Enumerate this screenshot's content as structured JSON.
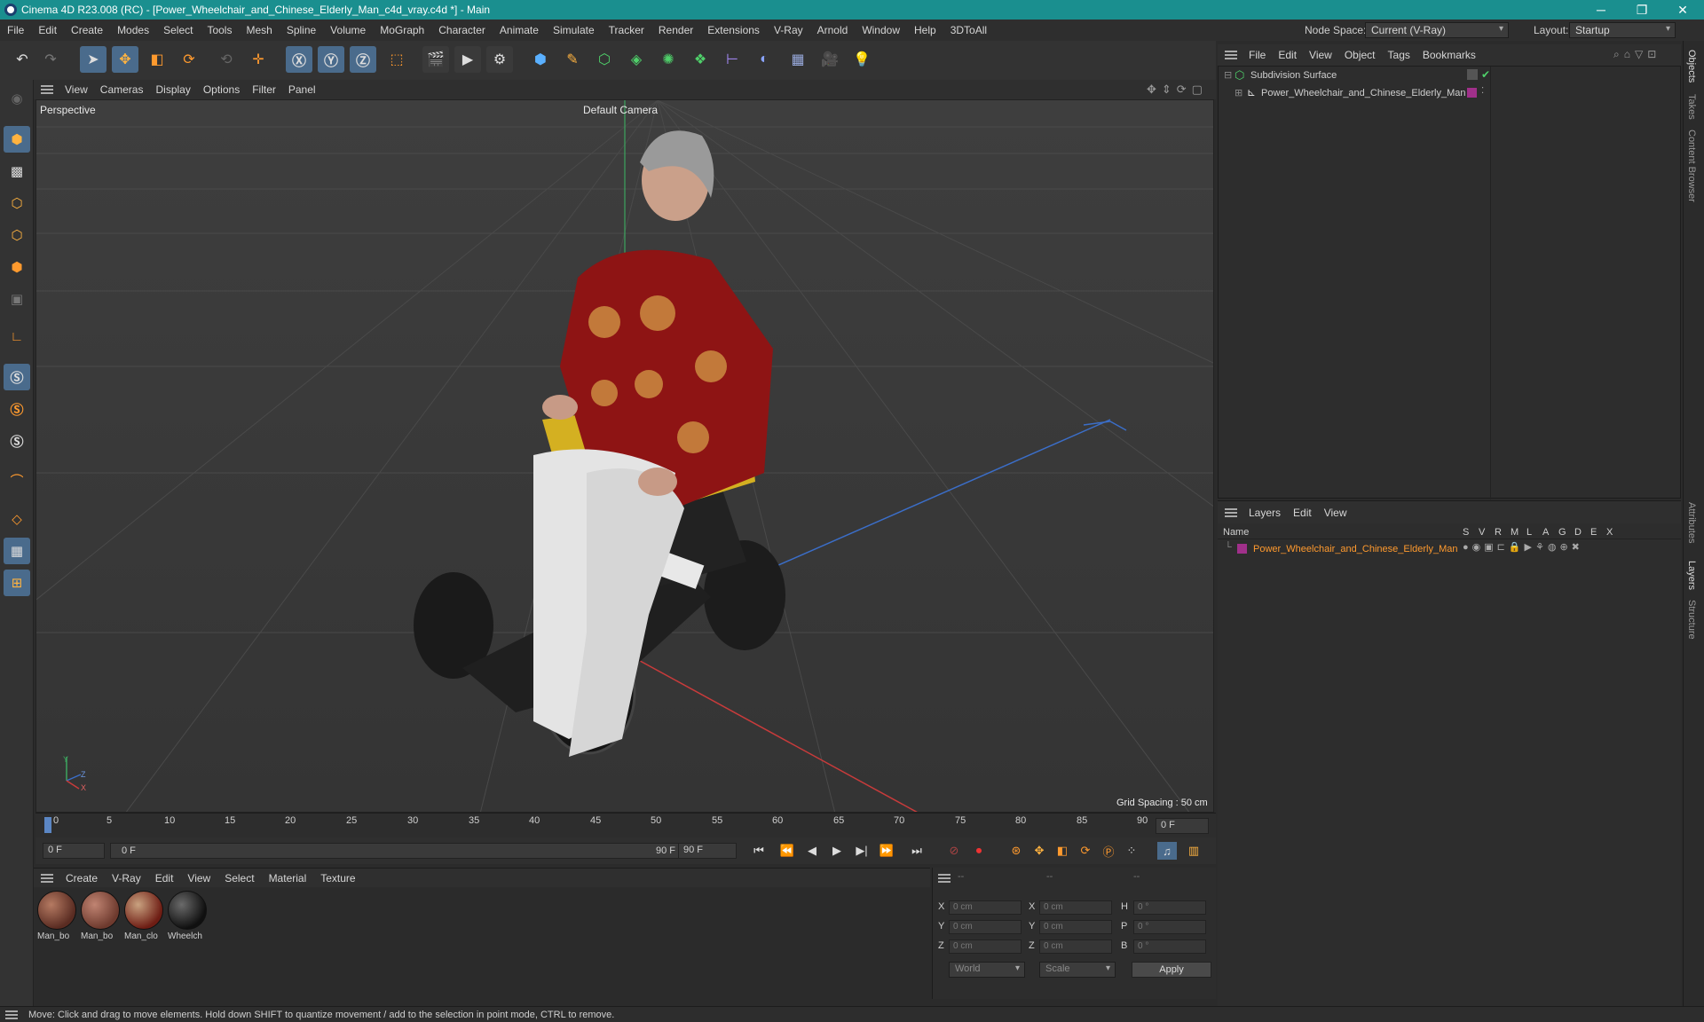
{
  "window": {
    "title": "Cinema 4D R23.008 (RC) - [Power_Wheelchair_and_Chinese_Elderly_Man_c4d_vray.c4d *] - Main",
    "minimize": "─",
    "restore": "❐",
    "close": "✕"
  },
  "menubar": {
    "items": [
      "File",
      "Edit",
      "Create",
      "Modes",
      "Select",
      "Tools",
      "Mesh",
      "Spline",
      "Volume",
      "MoGraph",
      "Character",
      "Animate",
      "Simulate",
      "Tracker",
      "Render",
      "Extensions",
      "V-Ray",
      "Arnold",
      "Window",
      "Help",
      "3DToAll"
    ],
    "node_space_label": "Node Space:",
    "node_space_value": "Current (V-Ray)",
    "layout_label": "Layout:",
    "layout_value": "Startup"
  },
  "viewport": {
    "menu": [
      "View",
      "Cameras",
      "Display",
      "Options",
      "Filter",
      "Panel"
    ],
    "view_name": "Perspective",
    "camera": "Default Camera",
    "grid_spacing": "Grid Spacing : 50 cm",
    "axis_y": "Y",
    "axis_z": "Z",
    "axis_x": "X"
  },
  "timeline": {
    "ticks": [
      "0",
      "5",
      "10",
      "15",
      "20",
      "25",
      "30",
      "35",
      "40",
      "45",
      "50",
      "55",
      "60",
      "65",
      "70",
      "75",
      "80",
      "85",
      "90"
    ],
    "frame_display": "0 F"
  },
  "playback": {
    "current_frame": "0 F",
    "range_start": "0 F",
    "range_end": "90 F",
    "max_frame": "90 F"
  },
  "materials": {
    "menu": [
      "Create",
      "V-Ray",
      "Edit",
      "View",
      "Select",
      "Material",
      "Texture"
    ],
    "items": [
      {
        "name": "Man_bo",
        "color": "#6b3a2e"
      },
      {
        "name": "Man_bo",
        "color": "#8a4a3a"
      },
      {
        "name": "Man_clo",
        "color": "#7a2b1e"
      },
      {
        "name": "Wheelch",
        "color": "#1c1c1c"
      }
    ]
  },
  "coordinates": {
    "headers": [
      "--",
      "--",
      "--"
    ],
    "rows": [
      {
        "l1": "X",
        "v1": "0 cm",
        "l2": "X",
        "v2": "0 cm",
        "l3": "H",
        "v3": "0 °"
      },
      {
        "l1": "Y",
        "v1": "0 cm",
        "l2": "Y",
        "v2": "0 cm",
        "l3": "P",
        "v3": "0 °"
      },
      {
        "l1": "Z",
        "v1": "0 cm",
        "l2": "Z",
        "v2": "0 cm",
        "l3": "B",
        "v3": "0 °"
      }
    ],
    "mode": "World",
    "size_mode": "Scale",
    "apply": "Apply"
  },
  "objects": {
    "menu": [
      "File",
      "Edit",
      "View",
      "Object",
      "Tags",
      "Bookmarks"
    ],
    "tree": [
      {
        "name": "Subdivision Surface",
        "indent": 0
      },
      {
        "name": "Power_Wheelchair_and_Chinese_Elderly_Man",
        "indent": 1
      }
    ]
  },
  "layers": {
    "menu": [
      "Layers",
      "Edit",
      "View"
    ],
    "column_name": "Name",
    "columns": [
      "S",
      "V",
      "R",
      "M",
      "L",
      "A",
      "G",
      "D",
      "E",
      "X"
    ],
    "rows": [
      {
        "name": "Power_Wheelchair_and_Chinese_Elderly_Man",
        "color": "#a0308a"
      }
    ]
  },
  "side_tabs": [
    "Objects",
    "Takes",
    "Content Browser",
    "Attributes",
    "Layers",
    "Structure"
  ],
  "status": "Move: Click and drag to move elements. Hold down SHIFT to quantize movement / add to the selection in point mode, CTRL to remove."
}
